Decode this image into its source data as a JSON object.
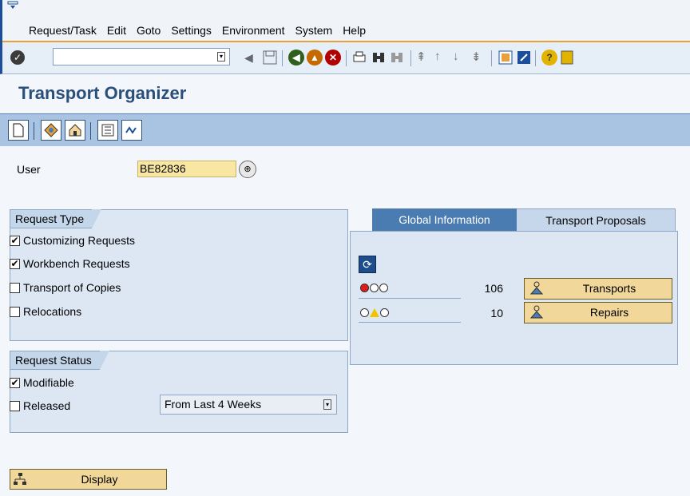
{
  "menu": {
    "items": [
      "Request/Task",
      "Edit",
      "Goto",
      "Settings",
      "Environment",
      "System",
      "Help"
    ]
  },
  "toolbar": {
    "command_value": "",
    "icons": [
      "enter-icon",
      "back-icon",
      "exit-icon",
      "cancel-icon",
      "print-icon",
      "find-icon",
      "find-next-icon",
      "first-page-icon",
      "previous-page-icon",
      "next-page-icon",
      "last-page-icon",
      "create-session-icon",
      "shortcut-icon",
      "help-icon"
    ]
  },
  "page": {
    "title": "Transport Organizer"
  },
  "user": {
    "label": "User",
    "value": "BE82836"
  },
  "request_type": {
    "title": "Request Type",
    "options": [
      {
        "label": "Customizing Requests",
        "checked": true
      },
      {
        "label": "Workbench Requests",
        "checked": true
      },
      {
        "label": "Transport of Copies",
        "checked": false
      },
      {
        "label": "Relocations",
        "checked": false
      }
    ]
  },
  "request_status": {
    "title": "Request Status",
    "modifiable": {
      "label": "Modifiable",
      "checked": true
    },
    "released": {
      "label": "Released",
      "checked": false
    },
    "period": "From Last 4 Weeks"
  },
  "tabs": {
    "active": "Global Information",
    "inactive": "Transport Proposals"
  },
  "global_info": {
    "rows": [
      {
        "count": "106",
        "button": "Transports"
      },
      {
        "count": "10",
        "button": "Repairs"
      }
    ]
  },
  "footer": {
    "display_button": "Display"
  },
  "check": "✔"
}
